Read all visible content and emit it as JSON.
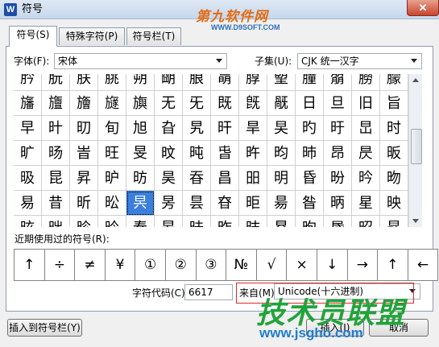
{
  "window": {
    "title": "符号",
    "app_icon": "W",
    "close": "✕"
  },
  "watermark_top": {
    "text": "第九软件网",
    "url": "WWW.D9SOFT.COM"
  },
  "watermark_bottom": {
    "text": "技术员联盟",
    "url": "www.jsgho.com"
  },
  "tabs": [
    {
      "label": "符号(S)"
    },
    {
      "label": "特殊字符(P)"
    },
    {
      "label": "符号栏(T)"
    }
  ],
  "font_row": {
    "font_label": "字体(F):",
    "font_value": "宋体",
    "subset_label": "子集(U):",
    "subset_value": "CJK 统一汉字"
  },
  "grid": {
    "rows": [
      [
        "肣",
        "朊",
        "朕",
        "朓",
        "朔",
        "朙",
        "朖",
        "朚",
        "朜",
        "朢",
        "朣",
        "朤",
        "朥",
        "朦"
      ],
      [
        "旛",
        "旜",
        "旝",
        "旞",
        "旟",
        "无",
        "旡",
        "既",
        "旣",
        "旤",
        "日",
        "旦",
        "旧",
        "旨"
      ],
      [
        "早",
        "旪",
        "旫",
        "旬",
        "旭",
        "旮",
        "旯",
        "旰",
        "旱",
        "旲",
        "旳",
        "旴",
        "旵",
        "时"
      ],
      [
        "旷",
        "旸",
        "旹",
        "旺",
        "旻",
        "旼",
        "旽",
        "旾",
        "旿",
        "昀",
        "昁",
        "昂",
        "昃",
        "昄"
      ],
      [
        "昅",
        "昆",
        "昇",
        "昈",
        "昉",
        "昊",
        "昋",
        "昌",
        "昍",
        "明",
        "昏",
        "昐",
        "昑",
        "昒"
      ],
      [
        "易",
        "昔",
        "昕",
        "昖",
        "昗",
        "昘",
        "昙",
        "昚",
        "昛",
        "昜",
        "昝",
        "昞",
        "星",
        "映"
      ],
      [
        "昡",
        "昢",
        "昣",
        "昤",
        "春",
        "昦",
        "昧",
        "昨",
        "昩",
        "昪",
        "昫",
        "昬",
        "昭",
        "昮"
      ]
    ],
    "selected": {
      "row": 5,
      "col": 4
    }
  },
  "recent": {
    "label": "近期使用过的符号(R):",
    "symbols": [
      "↑",
      "÷",
      "≠",
      "¥",
      "①",
      "②",
      "③",
      "№",
      "√",
      "×",
      "↓",
      "→",
      "↑",
      "←"
    ]
  },
  "code": {
    "label": "字符代码(C):",
    "value": "6617",
    "from_label": "来自(M)",
    "from_value": "Unicode(十六进制)"
  },
  "buttons": {
    "insert_to_bar": "插入到符号栏(Y)",
    "insert": "插入(I)",
    "cancel": "取消"
  }
}
